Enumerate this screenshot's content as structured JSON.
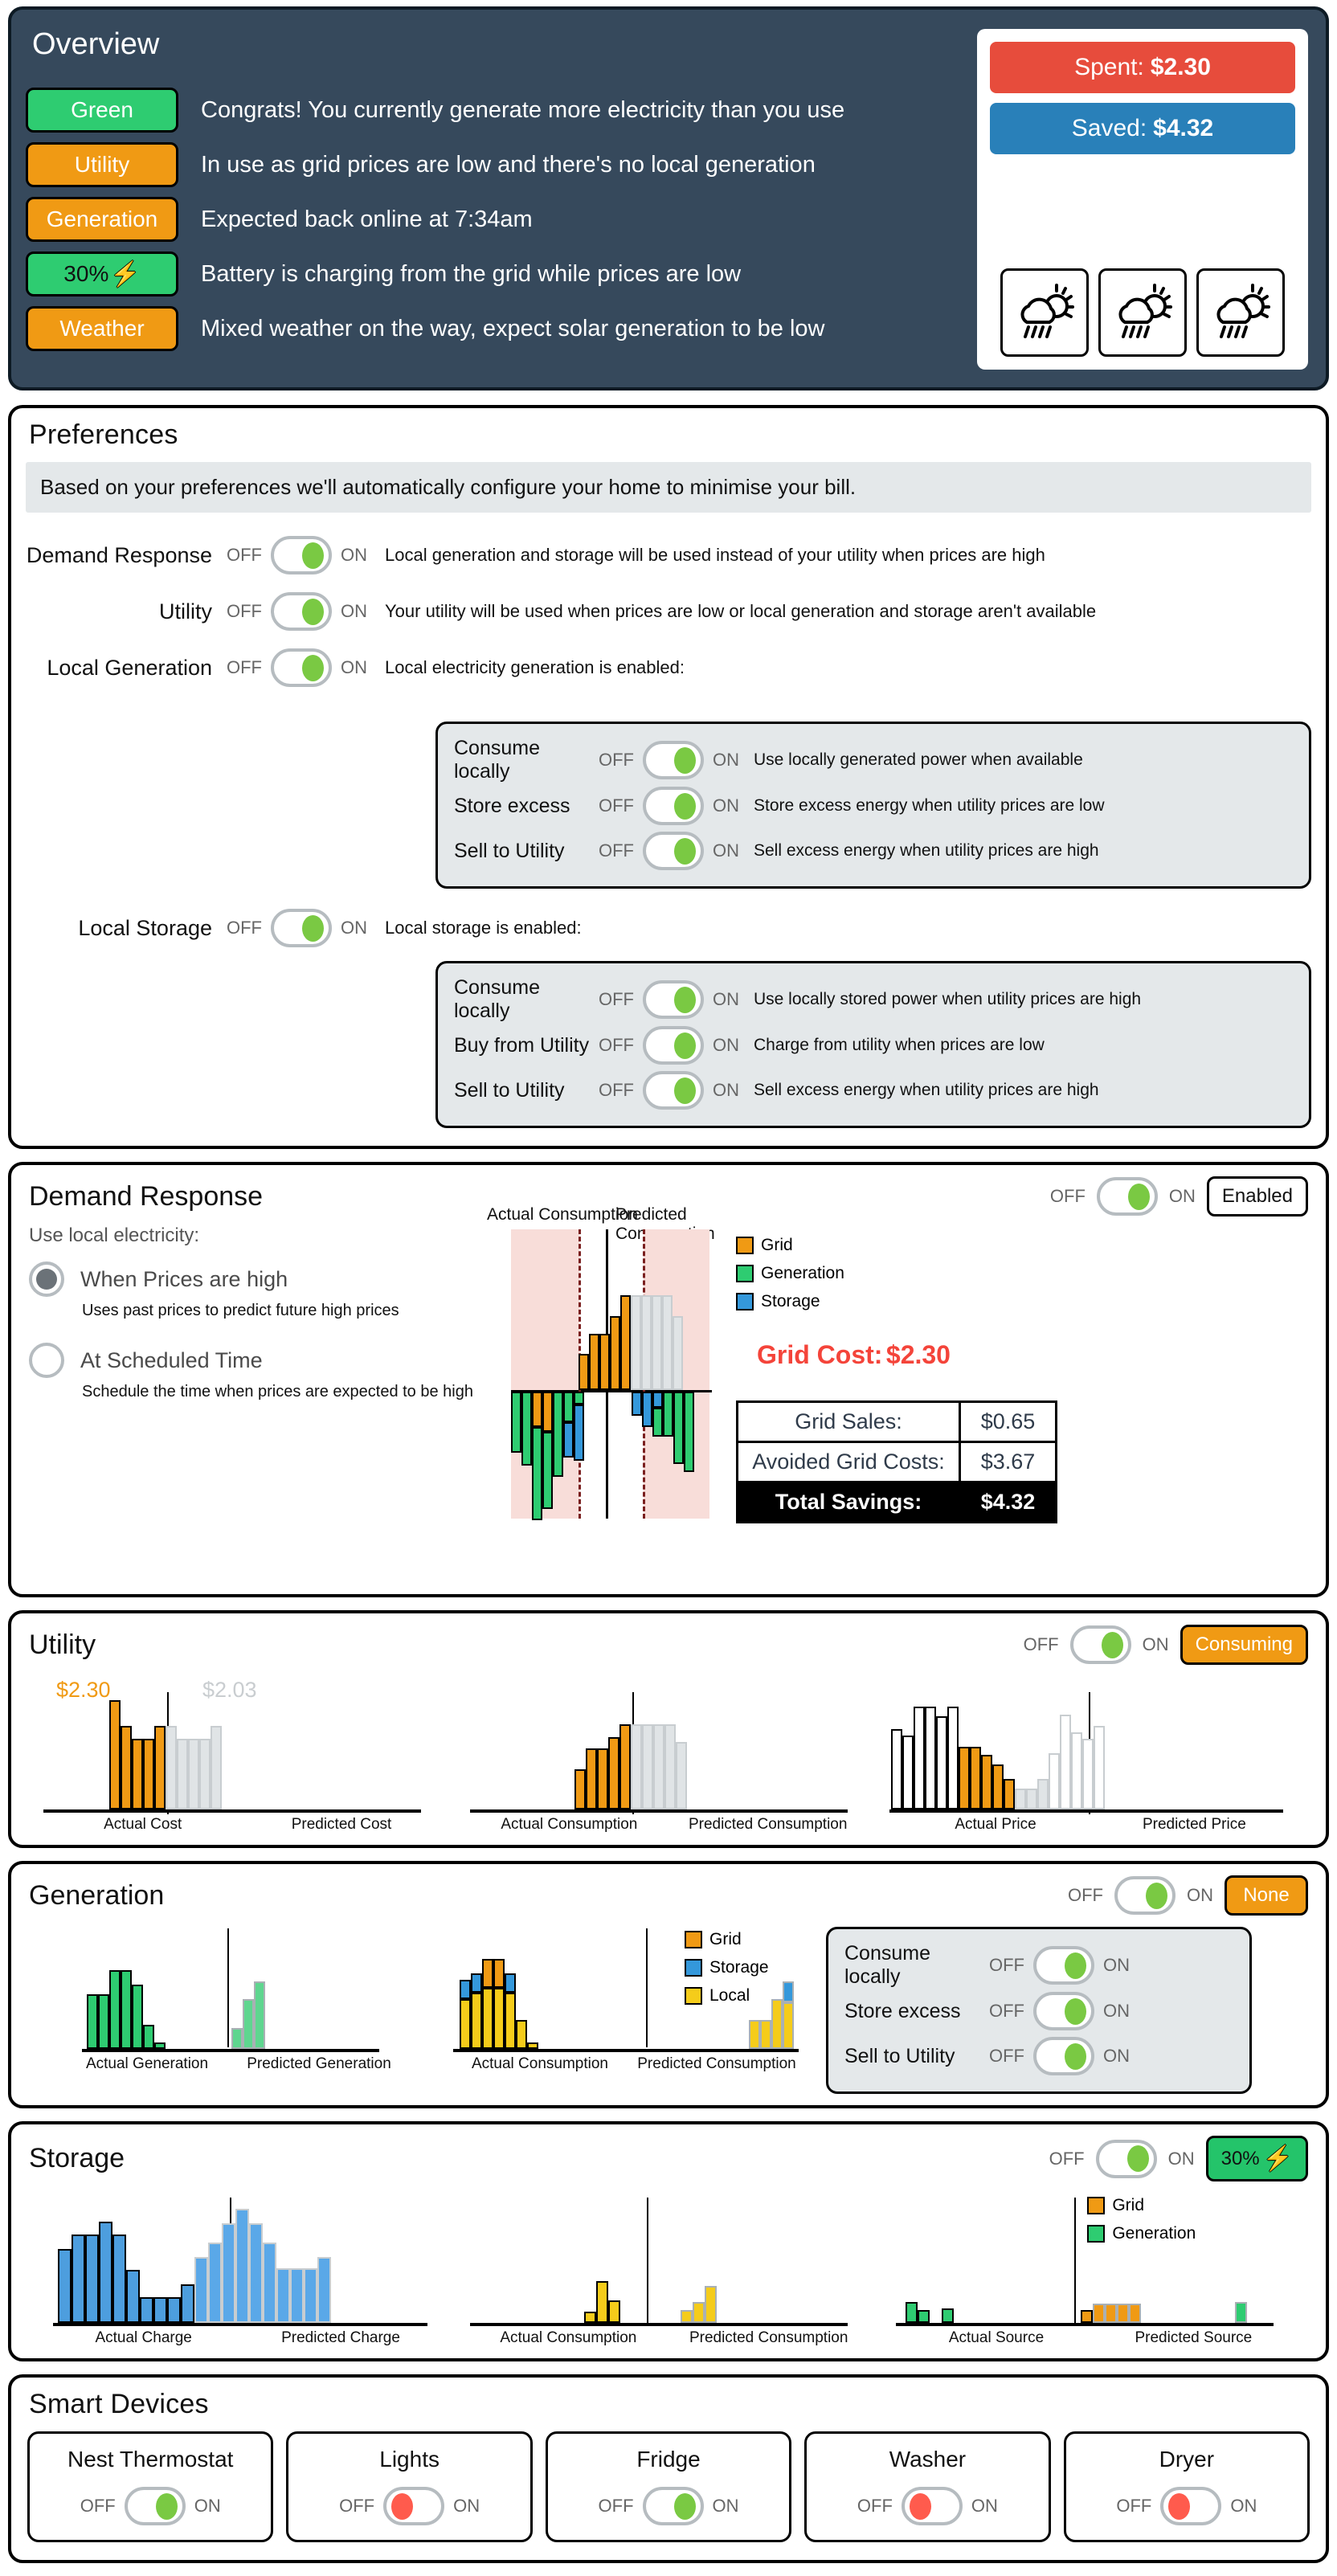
{
  "overview": {
    "title": "Overview",
    "rows": [
      {
        "badge": "Green",
        "badge_style": "green",
        "text": "Congrats! You currently generate more electricity than you use"
      },
      {
        "badge": "Utility",
        "badge_style": "orange",
        "text": "In use as grid prices are low and there's no local generation"
      },
      {
        "badge": "Generation",
        "badge_style": "orange",
        "text": "Expected back online at 7:34am"
      },
      {
        "badge": "30%",
        "badge_style": "battery",
        "text": "Battery is charging from the grid while prices are low"
      },
      {
        "badge": "Weather",
        "badge_style": "orange",
        "text": "Mixed weather on the way, expect solar generation to be low"
      }
    ],
    "spent_label": "Spent:",
    "spent_value": "$2.30",
    "saved_label": "Saved:",
    "saved_value": "$4.32",
    "weather_icons": [
      "cloud-sun-rain-icon",
      "cloud-sun-rain-icon",
      "cloud-sun-rain-icon"
    ],
    "colors": {
      "panel_bg": "#36495c",
      "green": "#2ecc71",
      "orange": "#f09a14",
      "spent": "#e74c3c",
      "saved": "#2980b9"
    }
  },
  "preferences": {
    "title": "Preferences",
    "note": "Based on your preferences we'll automatically configure your home to minimise your bill.",
    "off_label": "OFF",
    "on_label": "ON",
    "rows": [
      {
        "label": "Demand Response",
        "state": "on",
        "desc": "Local generation and storage will be used instead of your utility when prices are high"
      },
      {
        "label": "Utility",
        "state": "on",
        "desc": "Your utility will be used when prices are low or local generation and storage aren't available"
      },
      {
        "label": "Local Generation",
        "state": "on",
        "desc": "Local electricity generation is enabled:"
      }
    ],
    "generation_sub": [
      {
        "label": "Consume locally",
        "state": "on",
        "desc": "Use locally generated power when available"
      },
      {
        "label": "Store excess",
        "state": "on",
        "desc": "Store excess energy when utility prices are low"
      },
      {
        "label": "Sell to Utility",
        "state": "on",
        "desc": "Sell excess energy when utility prices are high"
      }
    ],
    "storage_row": {
      "label": "Local Storage",
      "state": "on",
      "desc": "Local storage is enabled:"
    },
    "storage_sub": [
      {
        "label": "Consume locally",
        "state": "on",
        "desc": "Use locally stored power when utility prices are high"
      },
      {
        "label": "Buy from Utility",
        "state": "on",
        "desc": "Charge from utility when prices are low"
      },
      {
        "label": "Sell to Utility",
        "state": "on",
        "desc": "Sell excess energy when utility prices are high"
      }
    ]
  },
  "demand_response": {
    "title": "Demand Response",
    "off_label": "OFF",
    "on_label": "ON",
    "toggle_state": "on",
    "status_pill": "Enabled",
    "use_local_label": "Use local electricity:",
    "options": [
      {
        "label": "When Prices are high",
        "selected": true,
        "help": "Uses past prices to predict future high prices"
      },
      {
        "label": "At Scheduled Time",
        "selected": false,
        "help": "Schedule the time when prices are expected to be high"
      }
    ],
    "grid_cost_label": "Grid Cost:",
    "grid_cost_value": "$2.30",
    "savings_rows": [
      {
        "label": "Grid Sales:",
        "value": "$0.65"
      },
      {
        "label": "Avoided Grid Costs:",
        "value": "$3.67"
      },
      {
        "label": "Total Savings:",
        "value": "$4.32"
      }
    ]
  },
  "utility": {
    "title": "Utility",
    "off_label": "OFF",
    "on_label": "ON",
    "toggle_state": "on",
    "status_pill": "Consuming",
    "actual_cost_value": "$2.30",
    "predicted_cost_value": "$2.03"
  },
  "generation": {
    "title": "Generation",
    "off_label": "OFF",
    "on_label": "ON",
    "toggle_state": "on",
    "status_pill": "None",
    "sub": [
      {
        "label": "Consume locally",
        "state": "on"
      },
      {
        "label": "Store excess",
        "state": "on"
      },
      {
        "label": "Sell to Utility",
        "state": "on"
      }
    ]
  },
  "storage": {
    "title": "Storage",
    "off_label": "OFF",
    "on_label": "ON",
    "toggle_state": "on",
    "status_pill": "30%"
  },
  "smart_devices": {
    "title": "Smart Devices",
    "off_label": "OFF",
    "on_label": "ON",
    "devices": [
      {
        "name": "Nest Thermostat",
        "state": "on"
      },
      {
        "name": "Lights",
        "state": "off"
      },
      {
        "name": "Fridge",
        "state": "on"
      },
      {
        "name": "Washer",
        "state": "off"
      },
      {
        "name": "Dryer",
        "state": "off"
      }
    ]
  },
  "chart_data": [
    {
      "id": "demand_response_chart",
      "type": "bar",
      "title": "",
      "stacked": true,
      "diverging": true,
      "top_labels": [
        "Actual Consumption",
        "Predicted Consumption"
      ],
      "legend": [
        {
          "name": "Grid",
          "color": "#f09a14"
        },
        {
          "name": "Generation",
          "color": "#2ecc71"
        },
        {
          "name": "Storage",
          "color": "#3498db"
        }
      ],
      "legend_position": "right",
      "highlight_bands": [
        "actual-high-price",
        "predicted-high-price"
      ],
      "highlight_color": "#f8ddd9",
      "positive_series": [
        {
          "name": "Grid",
          "values": [
            0,
            0,
            0,
            0,
            0,
            0,
            0,
            18,
            30,
            30,
            38,
            46,
            0,
            0,
            0,
            0,
            0,
            0,
            0,
            0
          ]
        },
        {
          "name": "Predicted",
          "values": [
            0,
            0,
            0,
            0,
            0,
            0,
            0,
            0,
            0,
            0,
            0,
            0,
            46,
            46,
            46,
            46,
            34,
            0,
            0,
            0
          ]
        }
      ],
      "negative_series": [
        {
          "name": "Generation",
          "values": [
            -30,
            -36,
            -62,
            -10,
            -74,
            -40,
            -28,
            -12,
            0,
            0,
            0,
            0,
            0,
            0,
            0,
            -6,
            -18,
            -24,
            -36,
            -30
          ]
        },
        {
          "name": "Grid",
          "values": [
            0,
            0,
            -18,
            -20,
            0,
            0,
            0,
            0,
            0,
            0,
            0,
            0,
            0,
            0,
            0,
            0,
            0,
            0,
            0,
            0
          ]
        },
        {
          "name": "Storage",
          "values": [
            0,
            0,
            0,
            0,
            0,
            -14,
            -24,
            -8,
            0,
            0,
            0,
            0,
            0,
            0,
            0,
            -10,
            -8,
            0,
            0,
            0
          ]
        }
      ],
      "ylabel": "",
      "xlabel": "",
      "grid": false
    },
    {
      "id": "utility_actual_cost",
      "type": "bar",
      "categories": [
        "Actual Cost",
        "Predicted Cost"
      ],
      "annotations": [
        {
          "text": "$2.30",
          "color": "#f09a14"
        },
        {
          "text": "$2.03",
          "color": "#c9cdd0"
        }
      ],
      "actual_values": [
        0,
        0,
        0,
        0,
        0,
        0,
        92,
        70,
        58,
        58,
        70,
        0,
        0,
        0
      ],
      "predicted_values": [
        0,
        0,
        0,
        0,
        0,
        0,
        0,
        0,
        0,
        0,
        0,
        72,
        58,
        58,
        58,
        72,
        0,
        0
      ],
      "series_color": "#f09a14",
      "predicted_color": "#e0e4e6",
      "ylabel": "",
      "grid": false
    },
    {
      "id": "utility_consumption",
      "type": "bar",
      "categories": [
        "Actual Consumption",
        "Predicted Consumption"
      ],
      "actual_values": [
        0,
        0,
        0,
        0,
        0,
        0,
        34,
        52,
        52,
        62,
        74,
        0,
        0,
        0
      ],
      "predicted_values": [
        0,
        0,
        0,
        0,
        0,
        0,
        0,
        0,
        0,
        0,
        0,
        74,
        74,
        74,
        74,
        58,
        0
      ],
      "series_color": "#f09a14",
      "predicted_color": "#e0e4e6",
      "ylabel": "",
      "grid": false
    },
    {
      "id": "utility_price",
      "type": "bar",
      "categories": [
        "Actual Price",
        "Predicted Price"
      ],
      "actual_values": [
        70,
        64,
        88,
        88,
        80,
        88,
        52,
        52,
        46,
        38,
        24,
        0,
        0
      ],
      "predicted_values": [
        0,
        0,
        0,
        0,
        0,
        0,
        0,
        0,
        0,
        0,
        0,
        16,
        16,
        22,
        0,
        48,
        64,
        58,
        54,
        0,
        66
      ],
      "series_color": "#f09a14",
      "outline_color": "#ffffff",
      "predicted_color": "#e0e4e6",
      "ylabel": "",
      "grid": false
    },
    {
      "id": "generation_generation",
      "type": "bar",
      "categories": [
        "Actual Generation",
        "Predicted Generation"
      ],
      "actual_values": [
        0,
        0,
        46,
        46,
        66,
        66,
        54,
        20,
        6,
        0,
        0,
        0
      ],
      "predicted_values": [
        0,
        0,
        0,
        0,
        0,
        0,
        0,
        0,
        0,
        0,
        18,
        44,
        58,
        0
      ],
      "series_color": "#2ecc71",
      "predicted_color": "#5ed68f",
      "ylabel": "",
      "grid": false
    },
    {
      "id": "generation_consumption",
      "type": "bar",
      "stacked": true,
      "categories": [
        "Actual Consumption",
        "Predicted Consumption"
      ],
      "legend": [
        {
          "name": "Grid",
          "color": "#f09a14"
        },
        {
          "name": "Storage",
          "color": "#3498db"
        },
        {
          "name": "Local",
          "color": "#f5cc1a"
        }
      ],
      "legend_position": "right",
      "actual_local": [
        0,
        0,
        40,
        48,
        54,
        54,
        54,
        24,
        4,
        0
      ],
      "actual_storage": [
        0,
        0,
        14,
        0,
        0,
        0,
        14,
        0,
        0,
        0
      ],
      "actual_grid": [
        0,
        0,
        0,
        0,
        24,
        24,
        0,
        0,
        0,
        0
      ],
      "predicted_local": [
        0,
        0,
        0,
        0,
        0,
        0,
        0,
        24,
        24,
        40,
        44
      ],
      "predicted_storage": [
        0,
        0,
        0,
        0,
        0,
        0,
        0,
        0,
        0,
        0,
        16
      ],
      "ylabel": "",
      "grid": false
    },
    {
      "id": "storage_charge",
      "type": "bar",
      "categories": [
        "Actual Charge",
        "Predicted Charge"
      ],
      "actual_values": [
        62,
        74,
        74,
        74,
        86,
        74,
        46,
        22,
        22,
        22,
        32
      ],
      "predicted_values": [
        56,
        68,
        84,
        96,
        84,
        68,
        56,
        46,
        46,
        46,
        56
      ],
      "series_color": "#4d9ede",
      "predicted_color": "#5aa8e8",
      "ylabel": "",
      "grid": false
    },
    {
      "id": "storage_consumption",
      "type": "bar",
      "categories": [
        "Actual Consumption",
        "Predicted Consumption"
      ],
      "actual_values": [
        0,
        0,
        0,
        8,
        28,
        14,
        0,
        0
      ],
      "predicted_values": [
        0,
        0,
        0,
        0,
        0,
        0,
        0,
        8,
        16,
        26,
        0
      ],
      "series_color": "#f5cc1a",
      "predicted_color": "#f5cc1a",
      "ylabel": "",
      "grid": false
    },
    {
      "id": "storage_source",
      "type": "bar",
      "stacked": true,
      "categories": [
        "Actual Source",
        "Predicted Source"
      ],
      "legend": [
        {
          "name": "Grid",
          "color": "#f09a14"
        },
        {
          "name": "Generation",
          "color": "#2ecc71"
        }
      ],
      "legend_position": "right",
      "actual_generation": [
        0,
        14,
        8,
        0,
        10,
        0
      ],
      "actual_grid": [
        0,
        0,
        0,
        0,
        0,
        0
      ],
      "predicted_grid": [
        0,
        0,
        0,
        0,
        8,
        14,
        14,
        14,
        14,
        0
      ],
      "predicted_generation": [
        0,
        0,
        0,
        0,
        0,
        0,
        0,
        0,
        0,
        0,
        14
      ],
      "ylabel": "",
      "grid": false
    }
  ]
}
